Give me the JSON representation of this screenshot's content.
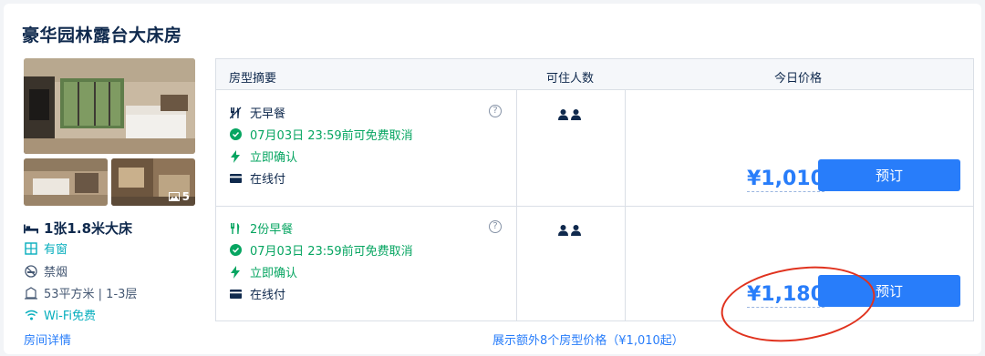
{
  "room": {
    "title": "豪华园林露台大床房",
    "photo_count": "5",
    "detail_link": "房间详情"
  },
  "amenities": {
    "bed": "1张1.8米大床",
    "window": "有窗",
    "smoking": "禁烟",
    "area": "53平方米 | 1-3层",
    "wifi": "Wi-Fi免费"
  },
  "table": {
    "headers": {
      "summary": "房型摘要",
      "occupancy": "可住人数",
      "price": "今日价格"
    },
    "rows": [
      {
        "meal": "无早餐",
        "cancel": "07月03日 23:59前可免费取消",
        "confirm": "立即确认",
        "payment": "在线付",
        "help": "?",
        "price": "¥1,010",
        "book": "预订"
      },
      {
        "meal": "2份早餐",
        "cancel": "07月03日 23:59前可免费取消",
        "confirm": "立即确认",
        "payment": "在线付",
        "help": "?",
        "price": "¥1,180",
        "book": "预订"
      }
    ]
  },
  "more_link": "展示额外8个房型价格（¥1,010起）",
  "colors": {
    "primary": "#287dfa",
    "green": "#06a561",
    "teal": "#06aebd",
    "text": "#0f294d",
    "annotation": "#e0321e"
  }
}
